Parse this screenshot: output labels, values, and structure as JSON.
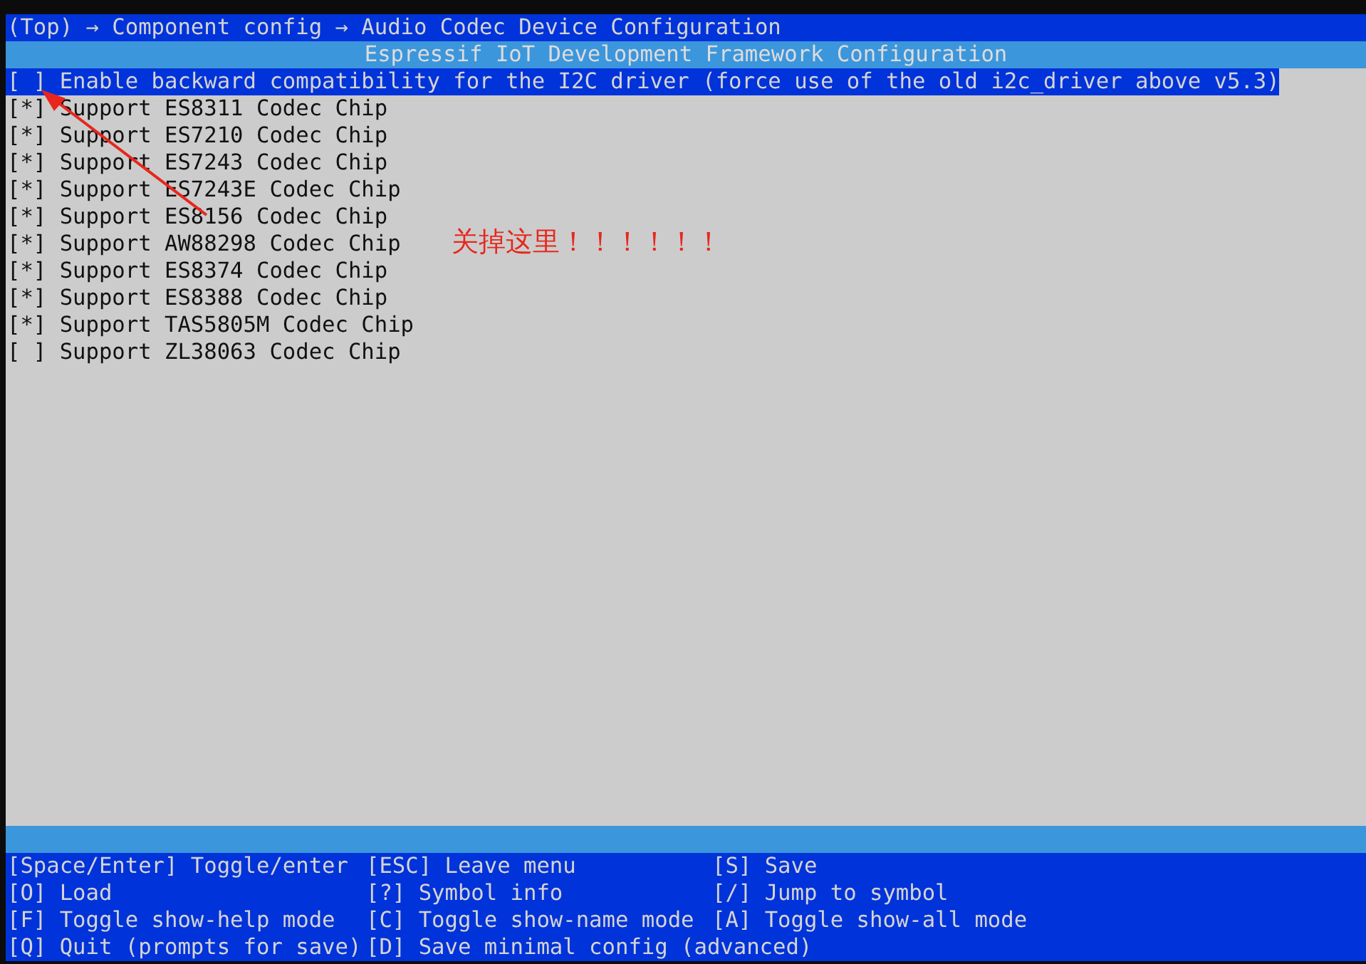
{
  "breadcrumb": "(Top) → Component config → Audio Codec Device Configuration",
  "title": "Espressif IoT Development Framework Configuration",
  "items": [
    {
      "box": "[ ]",
      "label": "Enable backward compatibility for the I2C driver (force use of the old i2c_driver above v5.3)",
      "selected": true
    },
    {
      "box": "[*]",
      "label": "Support ES8311 Codec Chip",
      "selected": false
    },
    {
      "box": "[*]",
      "label": "Support ES7210 Codec Chip",
      "selected": false
    },
    {
      "box": "[*]",
      "label": "Support ES7243 Codec Chip",
      "selected": false
    },
    {
      "box": "[*]",
      "label": "Support ES7243E Codec Chip",
      "selected": false
    },
    {
      "box": "[*]",
      "label": "Support ES8156 Codec Chip",
      "selected": false
    },
    {
      "box": "[*]",
      "label": "Support AW88298 Codec Chip",
      "selected": false
    },
    {
      "box": "[*]",
      "label": "Support ES8374 Codec Chip",
      "selected": false
    },
    {
      "box": "[*]",
      "label": "Support ES8388 Codec Chip",
      "selected": false
    },
    {
      "box": "[*]",
      "label": "Support TAS5805M Codec Chip",
      "selected": false
    },
    {
      "box": "[ ]",
      "label": "Support ZL38063 Codec Chip",
      "selected": false
    }
  ],
  "annotation": {
    "text": "关掉这里！！！！！！"
  },
  "help": [
    [
      "[Space/Enter] Toggle/enter",
      "[ESC] Leave menu",
      "[S] Save"
    ],
    [
      "[O] Load",
      "[?] Symbol info",
      "[/] Jump to symbol"
    ],
    [
      "[F] Toggle show-help mode",
      "[C] Toggle show-name mode",
      "[A] Toggle show-all mode"
    ],
    [
      "[Q] Quit (prompts for save)",
      "[D] Save minimal config (advanced)"
    ]
  ]
}
